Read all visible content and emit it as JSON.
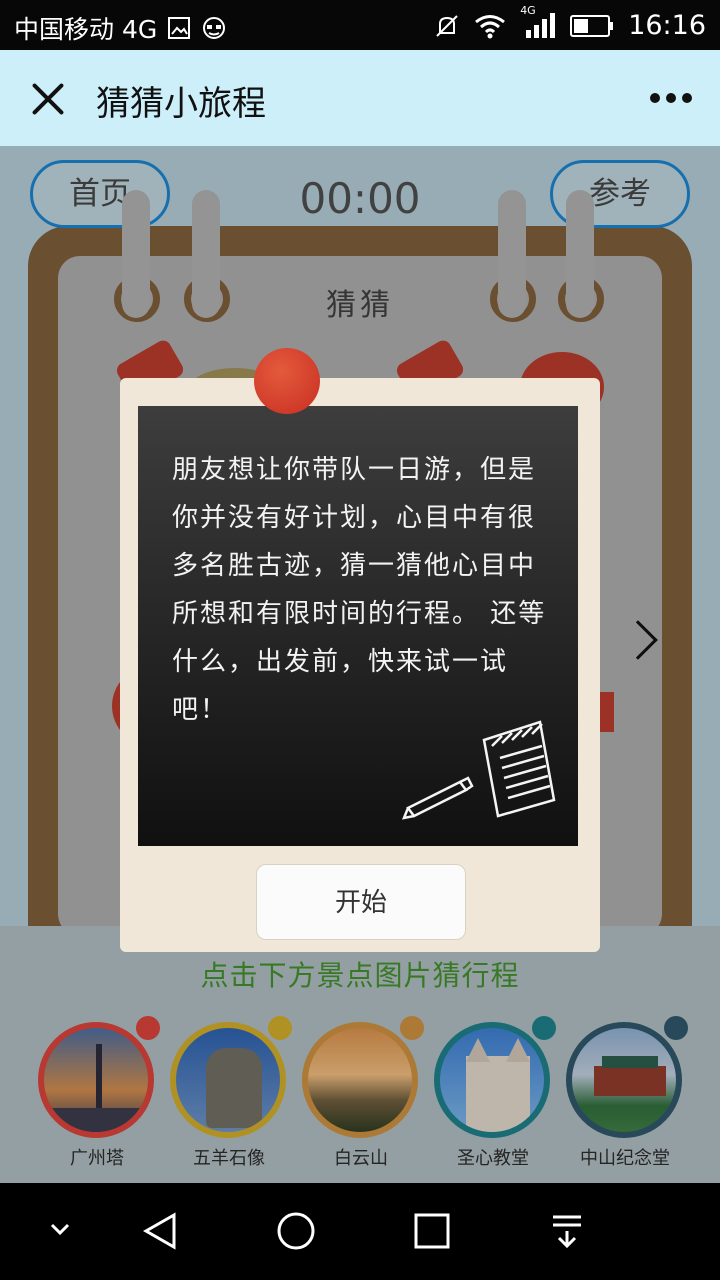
{
  "status_bar": {
    "carrier": "中国移动 4G",
    "time": "16:16",
    "signal_label": "4G"
  },
  "title_bar": {
    "title": "猜猜小旅程"
  },
  "game": {
    "home_label": "首页",
    "reference_label": "参考",
    "timer": "00:00",
    "board_label": "猜猜",
    "hint": "点击下方景点图片猜行程"
  },
  "spots": [
    {
      "label": "广州塔",
      "color": "#d2413a"
    },
    {
      "label": "五羊石像",
      "color": "#c9a52a"
    },
    {
      "label": "白云山",
      "color": "#c48b3e"
    },
    {
      "label": "圣心教堂",
      "color": "#1e7b84"
    },
    {
      "label": "中山纪念堂",
      "color": "#2d5467"
    }
  ],
  "modal": {
    "text": "朋友想让你带队一日游，但是你并没有好计划，心目中有很多名胜古迹，猜一猜他心目中所想和有限时间的行程。 还等什么，出发前，快来试一试吧！",
    "start_label": "开始"
  },
  "colors": {
    "title_bg": "#cdeff9",
    "pill_border": "#1a7fc6",
    "hint": "#3f8a2a",
    "board_frame": "#7a5a38"
  }
}
